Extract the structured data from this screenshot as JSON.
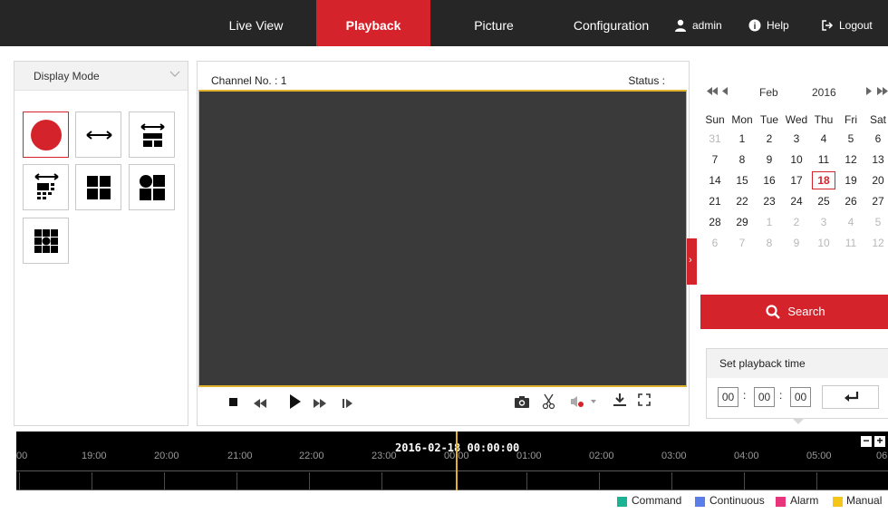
{
  "nav": {
    "tabs": [
      {
        "label": "Live View"
      },
      {
        "label": "Playback"
      },
      {
        "label": "Picture"
      },
      {
        "label": "Configuration"
      }
    ],
    "user_label": "admin",
    "help_label": "Help",
    "logout_label": "Logout",
    "active_tab": "Playback",
    "accent_color": "#d5232c"
  },
  "display_mode": {
    "title": "Display Mode",
    "layouts": [
      "single-record",
      "fisheye-panorama",
      "panorama-plus-3",
      "panorama-plus-8",
      "quad",
      "one-plus-three",
      "one-plus-eight"
    ],
    "active_layout": "single-record"
  },
  "player": {
    "channel_label": "Channel No. : 1",
    "status_label": "Status :",
    "controls": [
      "stop-icon",
      "slow-icon",
      "play-icon",
      "fast-icon",
      "single-frame-icon",
      "capture-icon",
      "clip-icon",
      "audio-icon",
      "download-icon",
      "fullscreen-icon"
    ]
  },
  "calendar": {
    "month": "Feb",
    "year": "2016",
    "weekdays": [
      "Sun",
      "Mon",
      "Tue",
      "Wed",
      "Thu",
      "Fri",
      "Sat"
    ],
    "weeks": [
      [
        "31",
        "1",
        "2",
        "3",
        "4",
        "5",
        "6"
      ],
      [
        "7",
        "8",
        "9",
        "10",
        "11",
        "12",
        "13"
      ],
      [
        "14",
        "15",
        "16",
        "17",
        "18",
        "19",
        "20"
      ],
      [
        "21",
        "22",
        "23",
        "24",
        "25",
        "26",
        "27"
      ],
      [
        "28",
        "29",
        "1",
        "2",
        "3",
        "4",
        "5"
      ],
      [
        "6",
        "7",
        "8",
        "9",
        "10",
        "11",
        "12"
      ]
    ],
    "selected_day": "18",
    "prev_year_icon": "double-left-icon",
    "prev_month_icon": "left-icon",
    "next_month_icon": "right-icon",
    "next_year_icon": "double-right-icon"
  },
  "search": {
    "label": "Search"
  },
  "playback_time": {
    "title": "Set playback time",
    "hours": "00",
    "minutes": "00",
    "seconds": "00"
  },
  "timeline": {
    "current_datetime": "2016-02-18 00:00:00",
    "hour_labels": [
      ":00",
      "19:00",
      "20:00",
      "21:00",
      "22:00",
      "23:00",
      "00:00",
      "01:00",
      "02:00",
      "03:00",
      "04:00",
      "05:00",
      "06"
    ]
  },
  "legend": [
    {
      "label": "Command",
      "color": "#1bb394"
    },
    {
      "label": "Continuous",
      "color": "#5a7de8"
    },
    {
      "label": "Alarm",
      "color": "#e8347a"
    },
    {
      "label": "Manual",
      "color": "#f5c518"
    }
  ]
}
